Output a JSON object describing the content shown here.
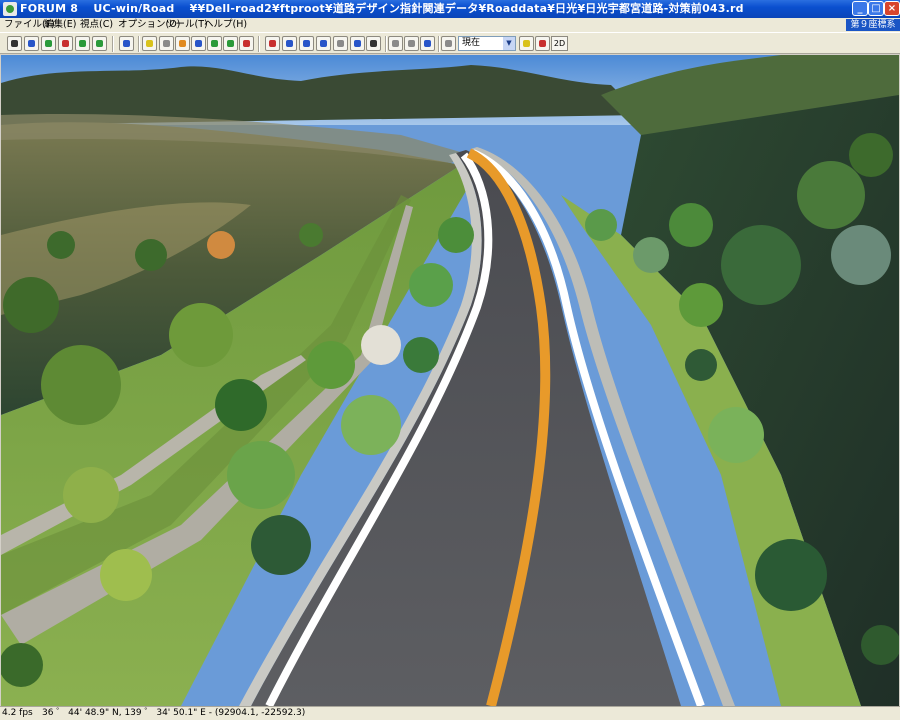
{
  "window": {
    "title": "FORUM 8 　UC-win/Road 　¥¥Dell-road2¥ftproot¥道路デザイン指針関連データ¥Roaddata¥日光¥日光宇都宮道路-対策前043.rd"
  },
  "menu": {
    "items": [
      "ファイル(F)",
      "編集(E)",
      "視点(C)",
      "オプション(O)",
      "ツール(T)",
      "ヘルプ(H)"
    ],
    "coord_system": "第９座標系"
  },
  "toolbar": {
    "view_select": "現在",
    "btn_2d": "2D"
  },
  "status": {
    "fps": "4.2 fps",
    "coords": "36 ゜ 44' 48.9\" N, 139 ゜ 34' 50.1\" E  -  (92904.1, -22592.3)"
  },
  "colors": {
    "center_line": "#e89a2a",
    "edge_line": "#ffffff",
    "asphalt": "#55565a",
    "grass": "#7fa24a"
  }
}
